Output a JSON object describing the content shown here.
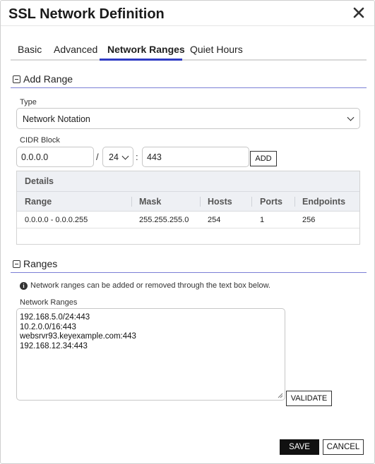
{
  "dialog": {
    "title": "SSL Network Definition"
  },
  "tabs": [
    {
      "label": "Basic"
    },
    {
      "label": "Advanced"
    },
    {
      "label": "Network Ranges"
    },
    {
      "label": "Quiet Hours"
    }
  ],
  "active_tab": "Network Ranges",
  "add_range": {
    "heading": "Add Range",
    "type_label": "Type",
    "type_value": "Network Notation",
    "cidr_label": "CIDR Block",
    "ip_value": "0.0.0.0",
    "slash": "/",
    "prefix_value": "24",
    "colon": ":",
    "port_value": "443",
    "add_button": "ADD"
  },
  "details": {
    "caption": "Details",
    "columns": [
      "Range",
      "Mask",
      "Hosts",
      "Ports",
      "Endpoints"
    ],
    "rows": [
      [
        "0.0.0.0 - 0.0.0.255",
        "255.255.255.0",
        "254",
        "1",
        "256"
      ]
    ]
  },
  "ranges": {
    "heading": "Ranges",
    "info_text": "Network ranges can be added or removed through the text box below.",
    "field_label": "Network Ranges",
    "lines": [
      "192.168.5.0/24:443",
      "10.2.0.0/16:443",
      "websrvr93.keyexample.com:443",
      "192.168.12.34:443"
    ],
    "validate_button": "VALIDATE"
  },
  "footer": {
    "save": "SAVE",
    "cancel": "CANCEL"
  },
  "colors": {
    "accent": "#2f3bc4",
    "section_rule": "#7b7fd6",
    "primary_button": "#111111"
  }
}
